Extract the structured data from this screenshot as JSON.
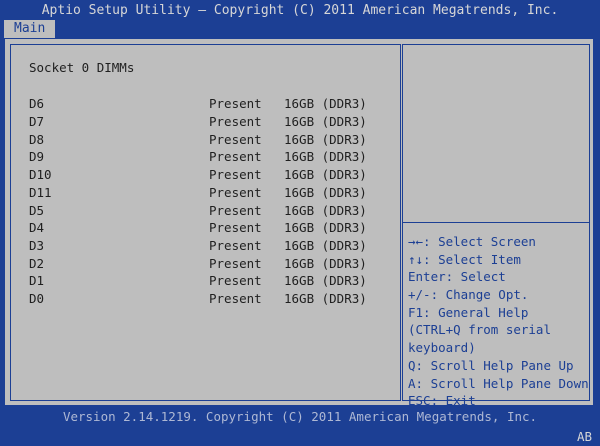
{
  "header": {
    "title": "Aptio Setup Utility – Copyright (C) 2011 American Megatrends, Inc."
  },
  "tabs": [
    {
      "label": "Main"
    }
  ],
  "main": {
    "section_title": "Socket 0 DIMMs",
    "dimms": [
      {
        "name": "D6",
        "status": "Present",
        "size": "16GB (DDR3)"
      },
      {
        "name": "D7",
        "status": "Present",
        "size": "16GB (DDR3)"
      },
      {
        "name": "D8",
        "status": "Present",
        "size": "16GB (DDR3)"
      },
      {
        "name": "D9",
        "status": "Present",
        "size": "16GB (DDR3)"
      },
      {
        "name": "D10",
        "status": "Present",
        "size": "16GB (DDR3)"
      },
      {
        "name": "D11",
        "status": "Present",
        "size": "16GB (DDR3)"
      },
      {
        "name": "D5",
        "status": "Present",
        "size": "16GB (DDR3)"
      },
      {
        "name": "D4",
        "status": "Present",
        "size": "16GB (DDR3)"
      },
      {
        "name": "D3",
        "status": "Present",
        "size": "16GB (DDR3)"
      },
      {
        "name": "D2",
        "status": "Present",
        "size": "16GB (DDR3)"
      },
      {
        "name": "D1",
        "status": "Present",
        "size": "16GB (DDR3)"
      },
      {
        "name": "D0",
        "status": "Present",
        "size": "16GB (DDR3)"
      }
    ]
  },
  "help": {
    "lines": [
      "→←: Select Screen",
      "↑↓: Select Item",
      "Enter: Select",
      "+/-: Change Opt.",
      "F1: General Help",
      "(CTRL+Q from serial",
      "keyboard)",
      "Q: Scroll Help Pane Up",
      "A: Scroll Help Pane Down",
      "ESC: Exit"
    ]
  },
  "footer": {
    "version": "Version 2.14.1219. Copyright (C) 2011 American Megatrends, Inc.",
    "corner": "AB"
  },
  "colors": {
    "background": "#1c3f94",
    "panel": "#bebebe",
    "text": "#1f1f1f",
    "accent": "#1c3f94"
  }
}
